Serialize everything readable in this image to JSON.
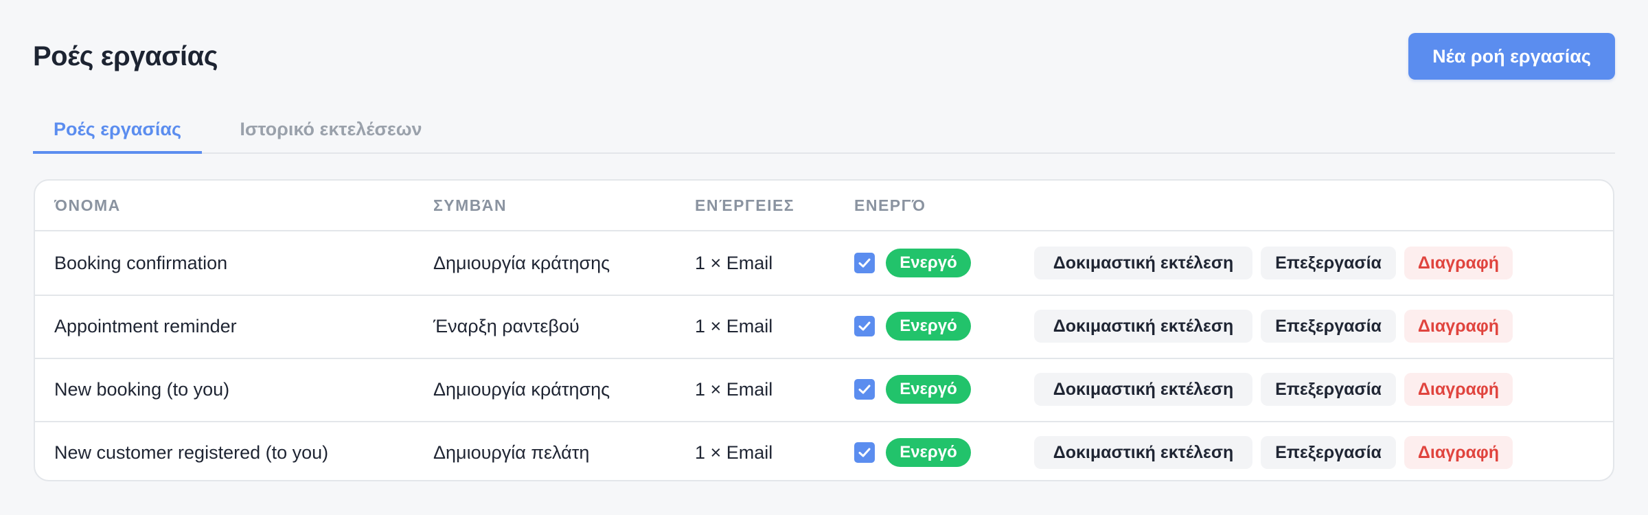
{
  "page": {
    "title": "Ροές εργασίας",
    "new_button": "Νέα ροή εργασίας"
  },
  "tabs": [
    {
      "label": "Ροές εργασίας",
      "active": true
    },
    {
      "label": "Ιστορικό εκτελέσεων",
      "active": false
    }
  ],
  "table": {
    "columns": [
      "ΌΝΟΜΑ",
      "ΣΥΜΒΆΝ",
      "ΕΝΈΡΓΕΙΕΣ",
      "ΕΝΕΡΓΌ"
    ],
    "rows": [
      {
        "name": "Booking confirmation",
        "event": "Δημιουργία κράτησης",
        "actions": "1 × Email",
        "enabled": true,
        "status": "Ενεργό",
        "test": "Δοκιμαστική εκτέλεση",
        "edit": "Επεξεργασία",
        "delete": "Διαγραφή"
      },
      {
        "name": "Appointment reminder",
        "event": "Έναρξη ραντεβού",
        "actions": "1 × Email",
        "enabled": true,
        "status": "Ενεργό",
        "test": "Δοκιμαστική εκτέλεση",
        "edit": "Επεξεργασία",
        "delete": "Διαγραφή"
      },
      {
        "name": "New booking (to you)",
        "event": "Δημιουργία κράτησης",
        "actions": "1 × Email",
        "enabled": true,
        "status": "Ενεργό",
        "test": "Δοκιμαστική εκτέλεση",
        "edit": "Επεξεργασία",
        "delete": "Διαγραφή"
      },
      {
        "name": "New customer registered (to you)",
        "event": "Δημιουργία πελάτη",
        "actions": "1 × Email",
        "enabled": true,
        "status": "Ενεργό",
        "test": "Δοκιμαστική εκτέλεση",
        "edit": "Επεξεργασία",
        "delete": "Διαγραφή"
      }
    ]
  },
  "colors": {
    "accent": "#5b8def",
    "success": "#22c36b",
    "danger": "#e0443e",
    "danger_bg": "#fdeeee",
    "muted_text": "#8a93a0"
  },
  "icons": {
    "checkbox": "checkmark-icon"
  }
}
